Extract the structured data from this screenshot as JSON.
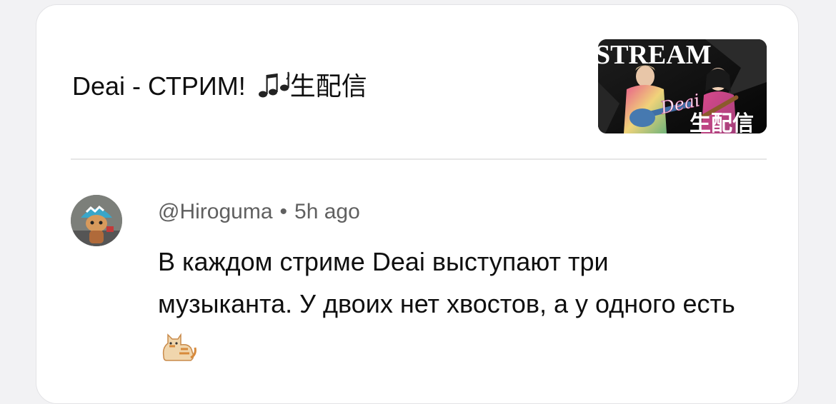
{
  "video": {
    "title": "Deai - СТРИМ!",
    "title_suffix": "生配信",
    "thumbnail": {
      "banner_text": "STREAM",
      "logo_text": "Deai",
      "overlay_text": "生配信"
    }
  },
  "comment": {
    "author": "@Hiroguma",
    "separator": "•",
    "time": "5h ago",
    "text": "В каждом стриме Deai выступают три музыканта. У двоих нет хвостов, а у одного есть"
  },
  "icons": {
    "music": "music-notes-icon",
    "cat": "cat-icon",
    "avatar": "avatar-figurine"
  },
  "colors": {
    "primary_text": "#0f0f0f",
    "secondary_text": "#606060",
    "divider": "#e6e6e6",
    "card_bg": "#ffffff",
    "page_bg": "#f2f2f4"
  }
}
